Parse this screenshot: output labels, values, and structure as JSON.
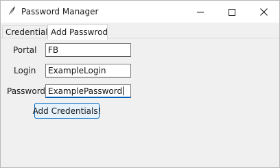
{
  "window": {
    "title": "Password Manager",
    "icon": "feather-icon"
  },
  "window_controls": [
    "minimize-icon",
    "maximize-icon",
    "close-icon"
  ],
  "tabs": [
    {
      "label": "Credentials",
      "active": false
    },
    {
      "label": "Add Passwrod",
      "active": true
    }
  ],
  "form": {
    "portal": {
      "label": "Portal",
      "value": "FB"
    },
    "login": {
      "label": "Login",
      "value": "ExampleLogin"
    },
    "password": {
      "label": "Password",
      "value": "ExamplePassword"
    },
    "submit_label": "Add Credentials!"
  },
  "colors": {
    "focus_accent": "#005fb8",
    "button_border": "#0067c0",
    "button_bg": "#e5f1fb"
  }
}
